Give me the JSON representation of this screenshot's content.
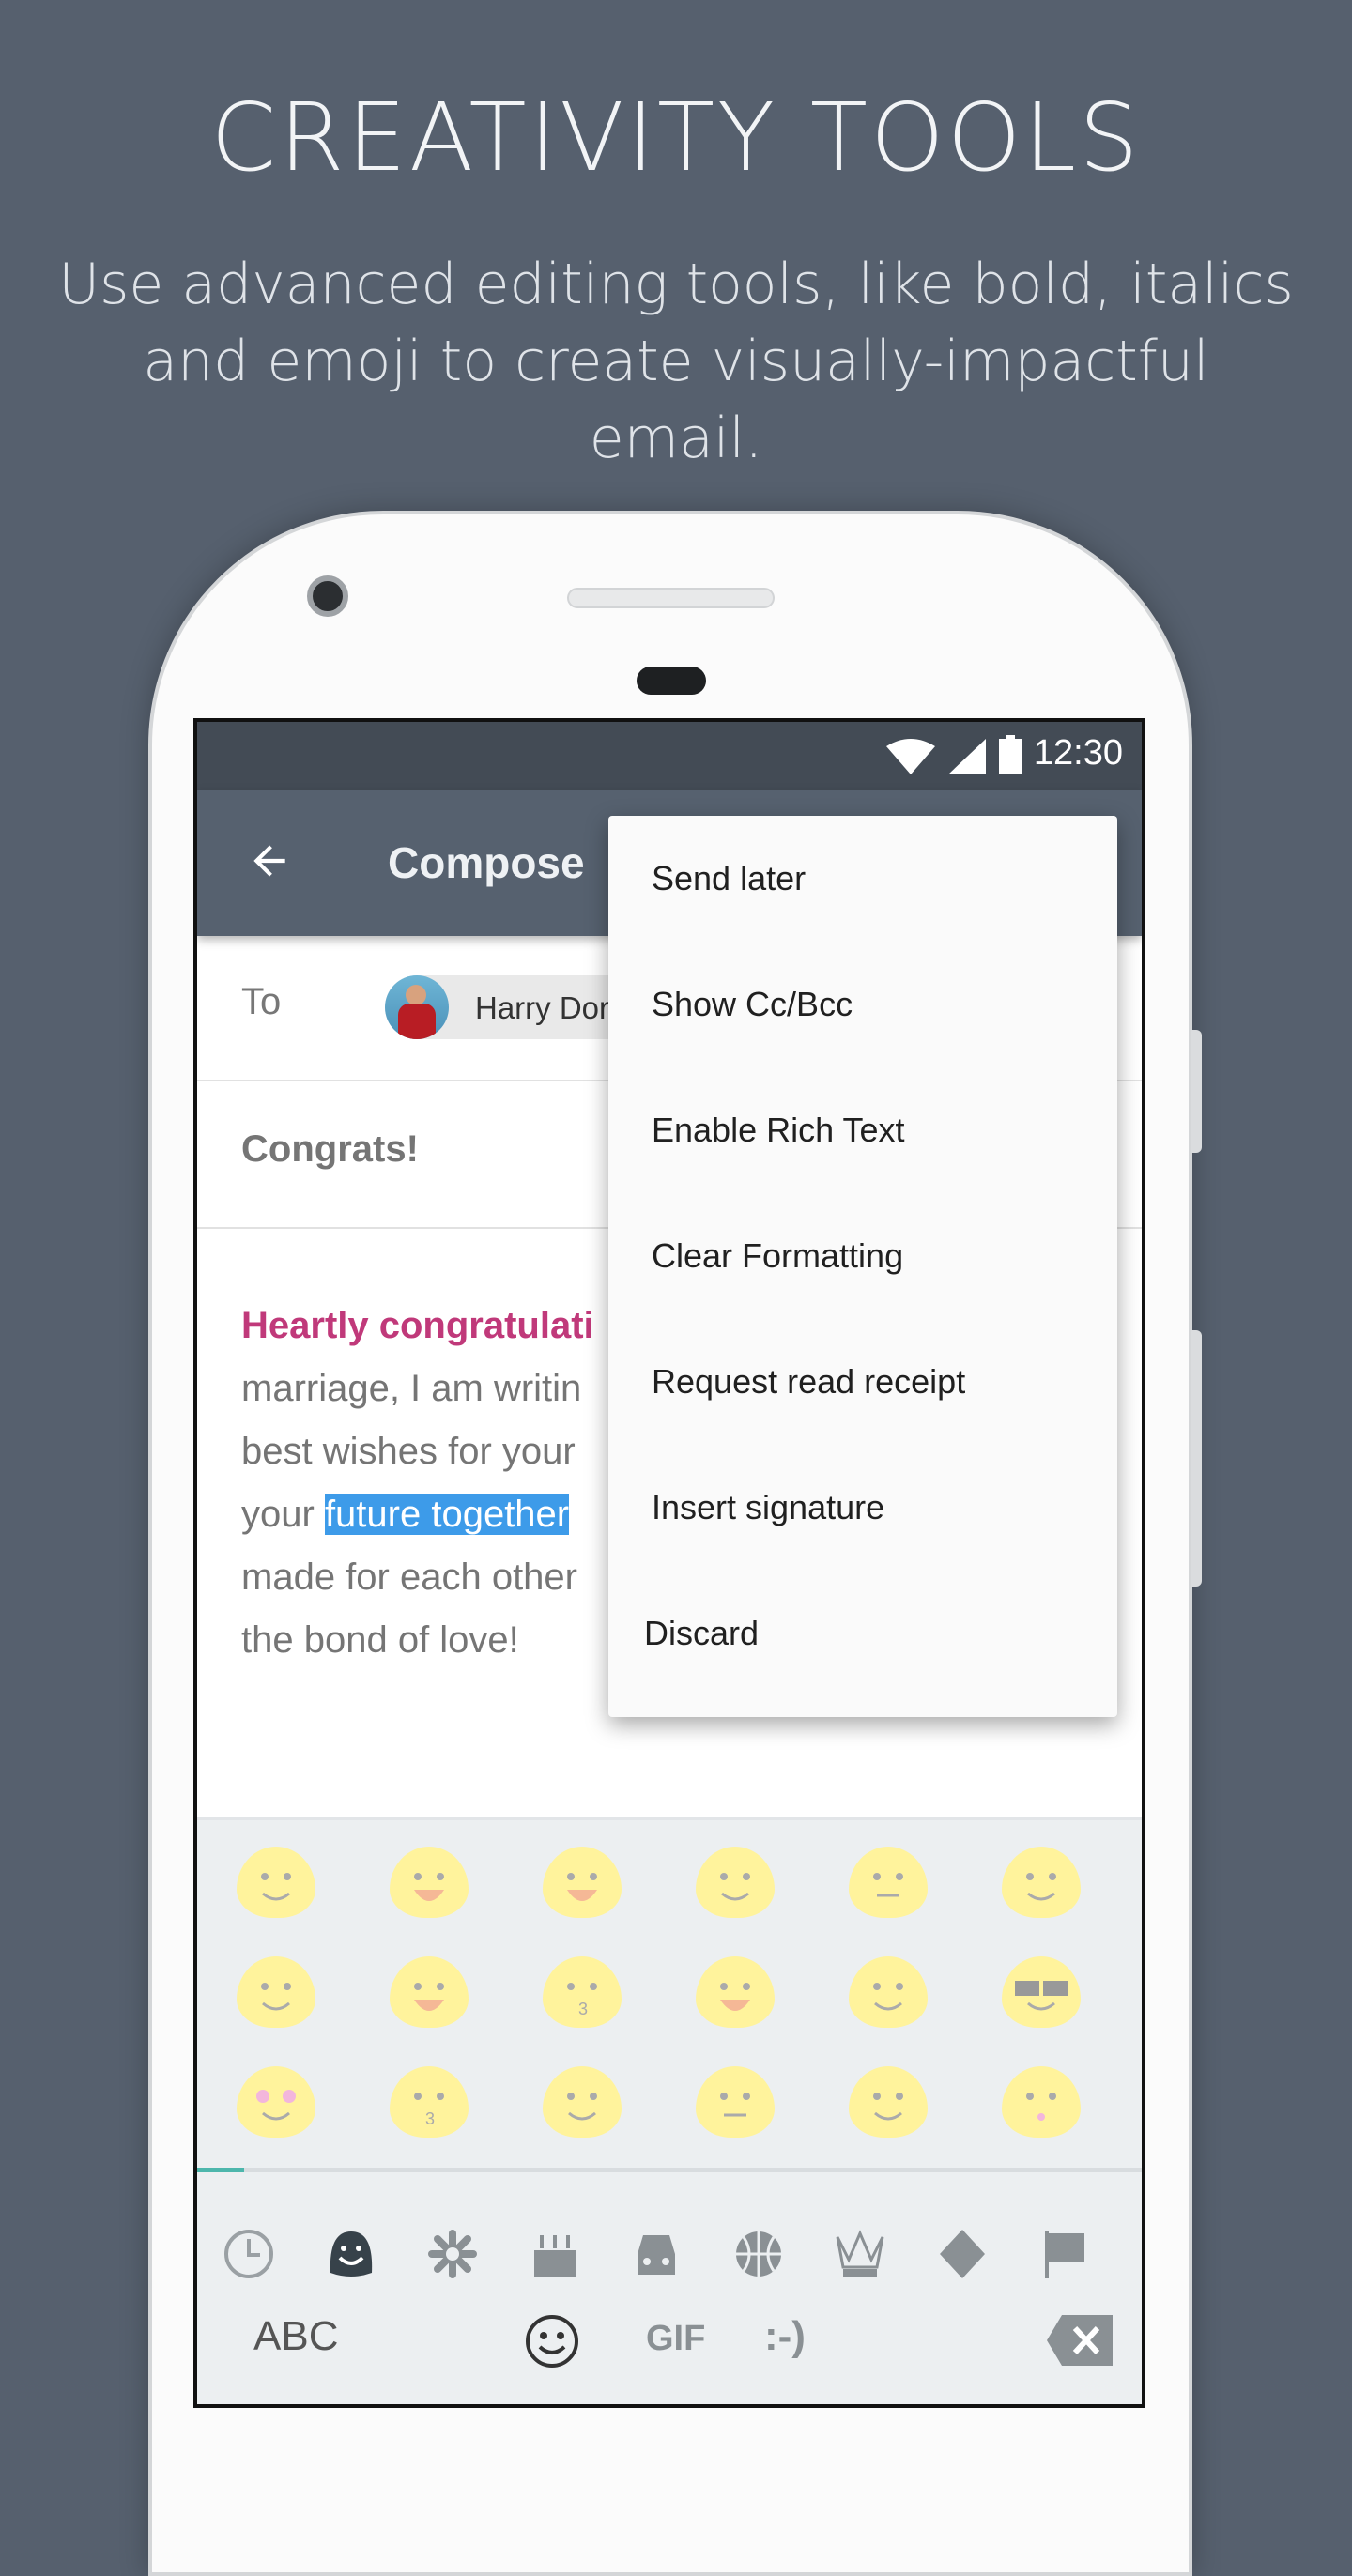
{
  "hero": {
    "title": "CREATIVITY TOOLS",
    "subtitle_line1": "Use advanced editing tools, like bold, italics",
    "subtitle_line2": "and emoji to create visually-impactful email."
  },
  "status_bar": {
    "time": "12:30",
    "icons": [
      "wifi-icon",
      "signal-icon",
      "battery-icon"
    ]
  },
  "toolbar": {
    "title": "Compose",
    "back_icon": "arrow-left-icon"
  },
  "compose": {
    "to_label": "To",
    "recipient": "Harry Dor",
    "subject": "Congrats!",
    "body": {
      "highlight": "Heartly congratulati",
      "line2": "marriage, I am writin",
      "line3": "best wishes for your",
      "line4_pre": "your ",
      "line4_selected": "future together",
      "line5": "made for each other",
      "line6": "the bond of love!"
    }
  },
  "menu": {
    "items": [
      "Send later",
      "Show Cc/Bcc",
      "Enable Rich Text",
      "Clear Formatting",
      "Request read receipt",
      "Insert signature",
      "Discard"
    ]
  },
  "keyboard": {
    "categories": [
      "recent-icon",
      "smiley-icon",
      "flower-icon",
      "cake-icon",
      "car-icon",
      "basketball-icon",
      "crown-icon",
      "diamond-icon",
      "flag-icon"
    ],
    "active_category": "smiley-icon",
    "abc_label": "ABC",
    "gif_label": "GIF",
    "emoticon_label": ":-)",
    "page_progress": 0.05,
    "accent": "#4db6ac"
  },
  "colors": {
    "background": "#56606e",
    "toolbar": "#56616f",
    "status_bar": "#434b55",
    "highlight_pink": "#c0397a",
    "selection": "#3d9be9"
  }
}
